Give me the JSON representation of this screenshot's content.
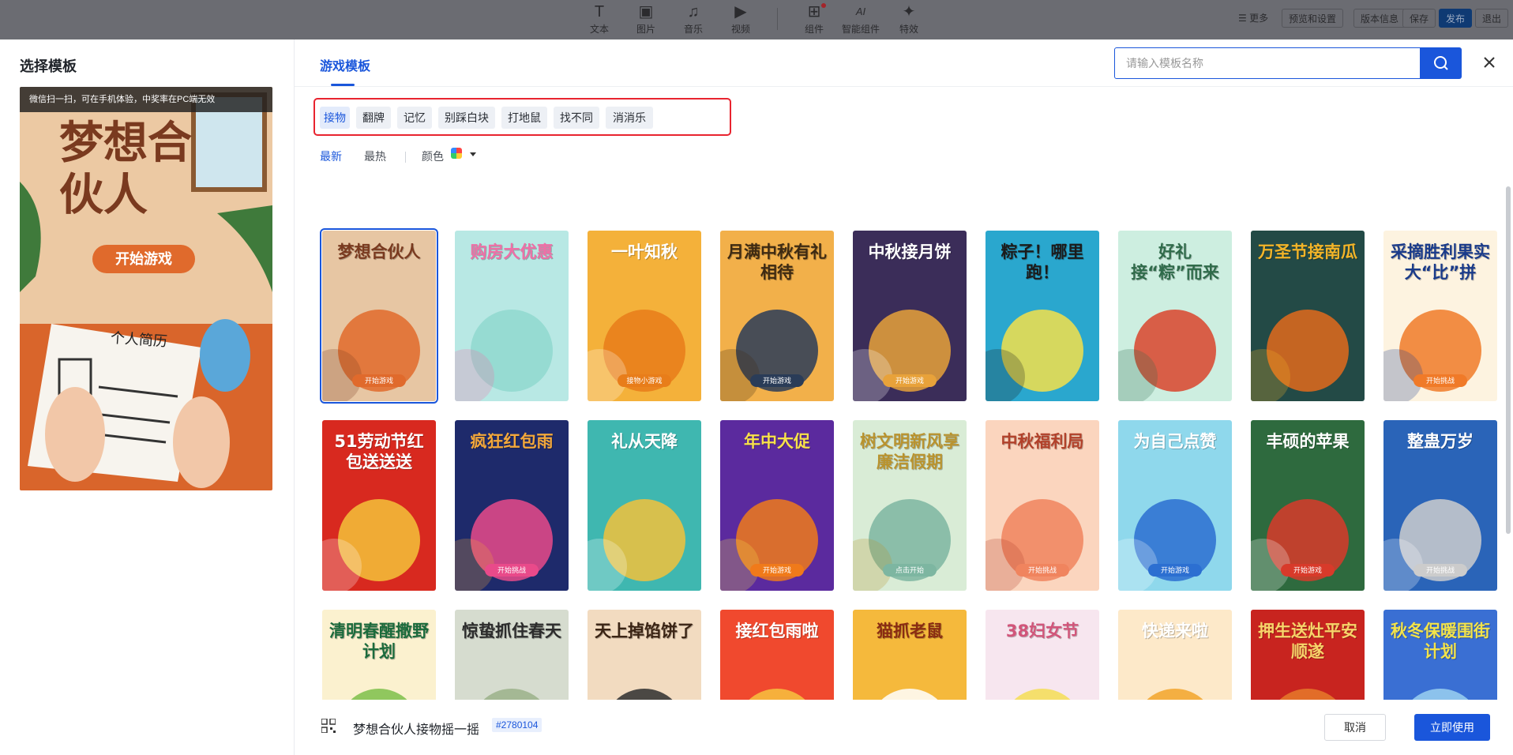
{
  "toolbar": {
    "tools": [
      {
        "label": "文本",
        "icon": "T"
      },
      {
        "label": "图片",
        "icon": "▣"
      },
      {
        "label": "音乐",
        "icon": "♫"
      },
      {
        "label": "视频",
        "icon": "▶"
      },
      {
        "label": "组件",
        "icon": "⊞"
      },
      {
        "label": "智能组件",
        "icon": "AI"
      },
      {
        "label": "特效",
        "icon": "✦"
      }
    ],
    "more": "更多",
    "preview": "预览和设置",
    "version": "版本信息",
    "save": "保存",
    "publish": "发布",
    "exit": "退出"
  },
  "modal": {
    "title": "选择模板",
    "preview_tip": "微信扫一扫，可在手机体验，中奖率在PC端无效",
    "preview_card": {
      "title": "梦想合伙人",
      "button": "开始游戏",
      "paper": "个人简历"
    },
    "tab": "游戏模板",
    "search_placeholder": "请输入模板名称",
    "categories": [
      "接物",
      "翻牌",
      "记忆",
      "别踩白块",
      "打地鼠",
      "找不同",
      "消消乐"
    ],
    "sort": {
      "newest": "最新",
      "hottest": "最热",
      "color": "颜色"
    },
    "templates": [
      {
        "title": "梦想合伙人",
        "button": "开始游戏",
        "bg": "#e7c6a3",
        "fg": "#7a3a1f",
        "accent": "#e06a2c"
      },
      {
        "title": "购房大优惠",
        "button": "",
        "bg": "#b8e8e4",
        "fg": "#ef6fa6",
        "accent": "#8fd8cf"
      },
      {
        "title": "一叶知秋",
        "button": "接物小游戏",
        "bg": "#f4b13a",
        "fg": "#ffffff",
        "accent": "#e87d1a"
      },
      {
        "title": "月满中秋有礼相待",
        "button": "开始游戏",
        "bg": "#f2b04a",
        "fg": "#3e2a12",
        "accent": "#2a3c58"
      },
      {
        "title": "中秋接月饼",
        "button": "开始游戏",
        "bg": "#3b2d59",
        "fg": "#ffffff",
        "accent": "#e8a23a"
      },
      {
        "title": "粽子！哪里跑！",
        "button": "",
        "bg": "#2aa7ce",
        "fg": "#1b1b1b",
        "accent": "#f4e04a"
      },
      {
        "title": "好礼接“粽”而来",
        "button": "",
        "bg": "#cdeee0",
        "fg": "#2f6b4a",
        "accent": "#d9442b"
      },
      {
        "title": "万圣节接南瓜",
        "button": "",
        "bg": "#234a46",
        "fg": "#f2b428",
        "accent": "#e26a1c"
      },
      {
        "title": "采摘胜利果实大“比”拼",
        "button": "开始挑战",
        "bg": "#fdf3e0",
        "fg": "#1a3b8a",
        "accent": "#f07a28"
      },
      {
        "title": "51劳动节红包送送送",
        "button": "",
        "bg": "#d8291f",
        "fg": "#ffffff",
        "accent": "#f5c23a"
      },
      {
        "title": "疯狂红包雨",
        "button": "开始挑战",
        "bg": "#1e2a6b",
        "fg": "#f4a83a",
        "accent": "#e94a8a"
      },
      {
        "title": "礼从天降",
        "button": "",
        "bg": "#3fb7b0",
        "fg": "#ffffff",
        "accent": "#f2c23c"
      },
      {
        "title": "年中大促",
        "button": "开始游戏",
        "bg": "#5b2a9e",
        "fg": "#f8e14a",
        "accent": "#f07a1a"
      },
      {
        "title": "树文明新风享廉洁假期",
        "button": "点击开始",
        "bg": "#d9ecd6",
        "fg": "#b9932e",
        "accent": "#7db6a1"
      },
      {
        "title": "中秋福利局",
        "button": "开始挑战",
        "bg": "#fbd5be",
        "fg": "#b2412a",
        "accent": "#f0845e"
      },
      {
        "title": "为自己点赞",
        "button": "开始游戏",
        "bg": "#8fd8ec",
        "fg": "#ffffff",
        "accent": "#2c6fd1"
      },
      {
        "title": "丰硕的苹果",
        "button": "开始游戏",
        "bg": "#2e6a3e",
        "fg": "#ffffff",
        "accent": "#d83a2a"
      },
      {
        "title": "整蛊万岁",
        "button": "开始挑战",
        "bg": "#2a64b8",
        "fg": "#ffffff",
        "accent": "#cccccc"
      },
      {
        "title": "清明春醒撒野计划",
        "button": "",
        "bg": "#fbf1cf",
        "fg": "#1b6b3c",
        "accent": "#7cc04a"
      },
      {
        "title": "惊蛰抓住春天",
        "button": "",
        "bg": "#d6dccf",
        "fg": "#2c2c2c",
        "accent": "#9bb18a"
      },
      {
        "title": "天上掉馅饼了",
        "button": "",
        "bg": "#f2dbc0",
        "fg": "#3b2414",
        "accent": "#2e2e2e"
      },
      {
        "title": "接红包雨啦",
        "button": "",
        "bg": "#f0492e",
        "fg": "#ffffff",
        "accent": "#f7c23e"
      },
      {
        "title": "猫抓老鼠",
        "button": "",
        "bg": "#f5b93c",
        "fg": "#8a2c12",
        "accent": "#ffffff"
      },
      {
        "title": "38妇女节",
        "button": "",
        "bg": "#f7e6ef",
        "fg": "#d2557a",
        "accent": "#f4dd55"
      },
      {
        "title": "快递来啦",
        "button": "",
        "bg": "#fde9c9",
        "fg": "#ffffff",
        "accent": "#f2a42a"
      },
      {
        "title": "押生送灶平安顺遂",
        "button": "",
        "bg": "#c8241f",
        "fg": "#f7d46a",
        "accent": "#e67a2a"
      },
      {
        "title": "秋冬保暖围街计划",
        "button": "",
        "bg": "#3a6fd3",
        "fg": "#f3e34a",
        "accent": "#9bd1f0"
      }
    ],
    "selected_name": "梦想合伙人接物摇一摇",
    "selected_id": "#2780104",
    "cancel": "取消",
    "use": "立即使用"
  },
  "colors": {
    "primary": "#1a56db",
    "highlight": "#e8242f"
  }
}
